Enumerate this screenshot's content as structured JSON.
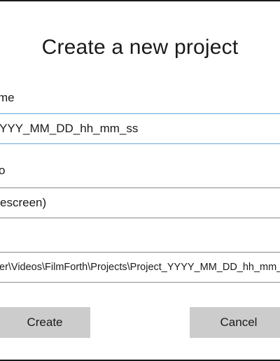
{
  "dialog": {
    "title": "Create a new project",
    "name_label": "me",
    "name_value": "YYY_MM_DD_hh_mm_ss",
    "ratio_label": "o",
    "ratio_value": "escreen)",
    "path_value": "er\\Videos\\FilmForth\\Projects\\Project_YYYY_MM_DD_hh_mm_ss",
    "create_label": "Create",
    "cancel_label": "Cancel"
  },
  "colors": {
    "focus_border": "#6aa7d8",
    "button_bg": "#cccccc",
    "text": "#1a1a1a"
  }
}
